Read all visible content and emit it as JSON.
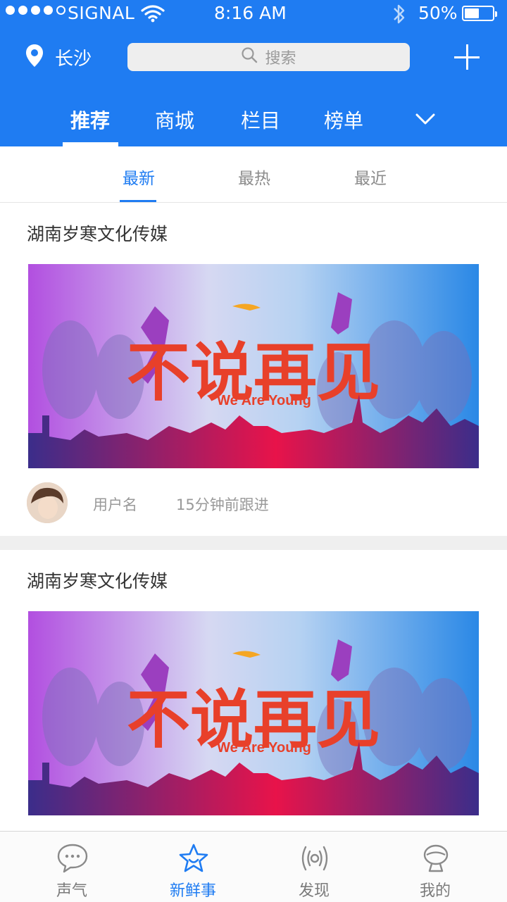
{
  "status_bar": {
    "carrier": "SIGNAL",
    "time": "8:16 AM",
    "battery": "50%",
    "battery_level": 0.5
  },
  "header": {
    "location": "长沙",
    "search_placeholder": "搜索",
    "tabs": [
      {
        "label": "推荐",
        "active": true
      },
      {
        "label": "商城",
        "active": false
      },
      {
        "label": "栏目",
        "active": false
      },
      {
        "label": "榜单",
        "active": false
      }
    ],
    "colors": {
      "primary": "#1f7cf2"
    }
  },
  "sub_tabs": [
    {
      "label": "最新",
      "active": true
    },
    {
      "label": "最热",
      "active": false
    },
    {
      "label": "最近",
      "active": false
    }
  ],
  "posts": [
    {
      "title": "湖南岁寒文化传媒",
      "banner": {
        "headline": "不说再见",
        "tagline": "We Are Young"
      },
      "user": "用户名",
      "time": "15分钟前跟进"
    },
    {
      "title": "湖南岁寒文化传媒",
      "banner": {
        "headline": "不说再见",
        "tagline": "We Are Young"
      }
    }
  ],
  "bottom_nav": [
    {
      "label": "声气",
      "icon": "chat-bubble-icon",
      "active": false
    },
    {
      "label": "新鲜事",
      "icon": "star-icon",
      "active": true
    },
    {
      "label": "发现",
      "icon": "broadcast-icon",
      "active": false
    },
    {
      "label": "我的",
      "icon": "user-icon",
      "active": false
    }
  ]
}
